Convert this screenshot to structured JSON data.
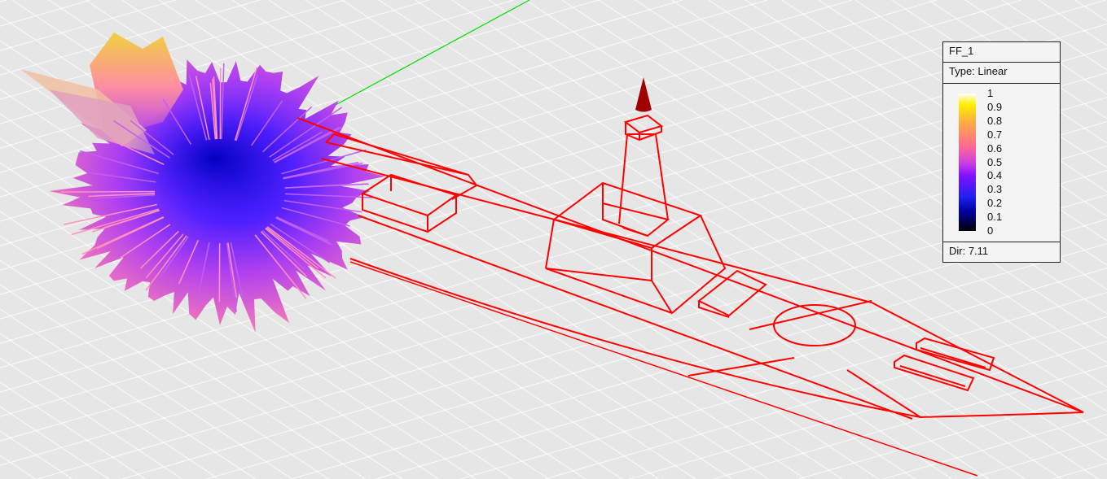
{
  "legend": {
    "title": "FF_1",
    "type": "Type: Linear",
    "ticks": [
      "1",
      "0.9",
      "0.8",
      "0.7",
      "0.6",
      "0.5",
      "0.4",
      "0.3",
      "0.2",
      "0.1",
      "0"
    ],
    "dir": "Dir: 7.11"
  },
  "colors": {
    "background": "#e6e6e6",
    "grid": "#ffffff",
    "wireframe": "#ff0000",
    "axis_y": "#00dd00",
    "pattern_low": "#2020f0",
    "pattern_mid": "#b040f0",
    "pattern_high": "#ff70a0"
  }
}
